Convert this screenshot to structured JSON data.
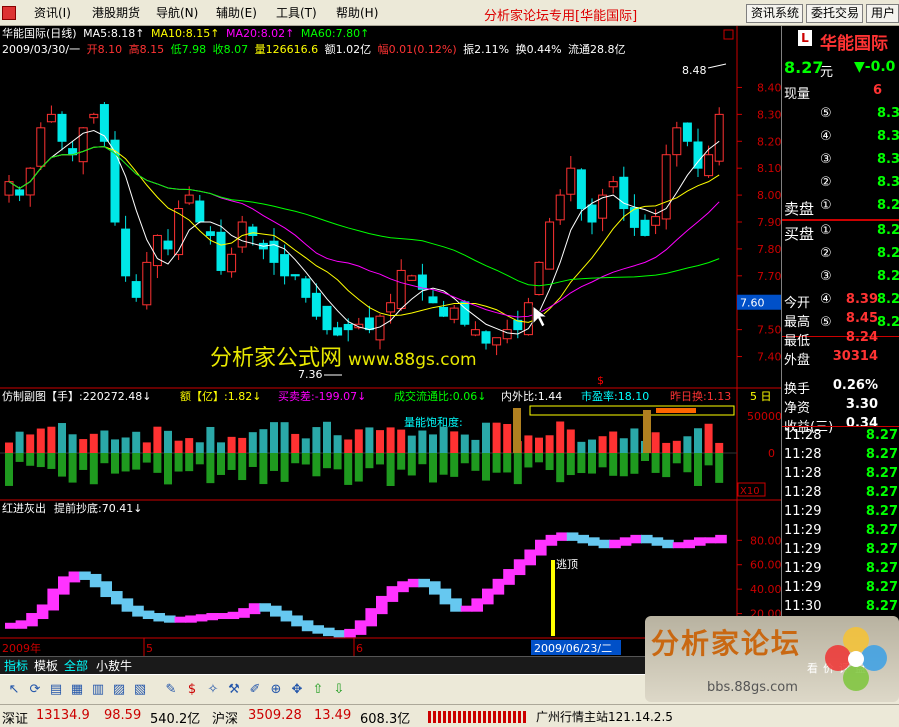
{
  "menu": {
    "items": [
      "资讯(I)",
      "港股期货",
      "导航(N)",
      "辅助(E)",
      "工具(T)",
      "帮助(H)"
    ],
    "forum_tag": "分析家论坛专用",
    "broker_tag": "[华能国际]",
    "buttons": [
      "资讯系统",
      "委托交易",
      "用户"
    ]
  },
  "main_chart": {
    "title": "华能国际(日线)",
    "ma5": "MA5:8.18↑",
    "ma10": "MA10:8.15↑",
    "ma20": "MA20:8.02↑",
    "ma60": "MA60:7.80↑",
    "date": "2009/03/30/一",
    "open": "开8.10",
    "high": "高8.15",
    "low": "低7.98",
    "close": "收8.07",
    "vol": "量126616.6",
    "amount": "额1.02亿",
    "change": "幅0.01(0.12%)",
    "amplitude": "振2.11%",
    "turnover": "换0.44%",
    "float": "流通28.8亿",
    "price_ticks": [
      "8.40",
      "8.30",
      "8.20",
      "8.10",
      "8.00",
      "7.90",
      "7.80",
      "7.70",
      "7.60",
      "7.50",
      "7.40"
    ],
    "cursor_price": "7.60",
    "high_marker": "8.48",
    "low_marker": "7.36"
  },
  "colors": {
    "up": "#ff3232",
    "down": "#00e8e8",
    "ma5": "#ffffff",
    "ma10": "#ffff00",
    "ma20": "#ff00ff",
    "ma60": "#00ff00",
    "yellow": "#ffff00"
  },
  "vol_panel": {
    "name": "仿制副图",
    "hand": "【手】:220272.48↓",
    "amount": "额【亿】:1.82↓",
    "buysell": "买卖差:-199.07↓",
    "flow": "成交流通比:0.06↓",
    "inout": "内外比:1.44",
    "pe": "市盈率:18.10",
    "prev_turn": "昨日换:1.13",
    "days": "5 日",
    "saturation": "量能饱和度:",
    "ticks": [
      "50000",
      "0"
    ],
    "scale": "X10"
  },
  "ind_panel": {
    "name": "红进灰出",
    "early_buy": "提前抄底:70.41↓",
    "escape": "逃顶",
    "ticks": [
      "80.00",
      "60.00",
      "40.00",
      "20.00"
    ]
  },
  "xaxis": {
    "labels": [
      "2009年",
      "5",
      "6"
    ],
    "cursor_date": "2009/06/23/二"
  },
  "watermark": {
    "text": "分析家公式网",
    "url": "www.88gs.com"
  },
  "right_panel": {
    "stock_name": "华能国际",
    "price": "8.27",
    "unit": "元",
    "change": "▼-0.0",
    "cur_vol_label": "现量",
    "cur_vol": "6",
    "asks": [
      {
        "label": "⑤",
        "price": "8.3"
      },
      {
        "label": "④",
        "price": "8.3"
      },
      {
        "label": "③",
        "price": "8.3"
      },
      {
        "label": "②",
        "price": "8.3"
      },
      {
        "label": "①",
        "price": "8.2"
      }
    ],
    "ask_title": "卖盘",
    "bid_title": "买盘",
    "bids": [
      {
        "label": "①",
        "price": "8.2"
      },
      {
        "label": "②",
        "price": "8.2"
      },
      {
        "label": "③",
        "price": "8.2"
      },
      {
        "label": "④",
        "price": "8.2"
      },
      {
        "label": "⑤",
        "price": "8.2"
      }
    ],
    "stats": [
      {
        "label": "今开",
        "value": "8.39"
      },
      {
        "label": "最高",
        "value": "8.45"
      },
      {
        "label": "最低",
        "value": "8.24"
      },
      {
        "label": "外盘",
        "value": "30314"
      },
      {
        "label": "换手",
        "value": "0.26%"
      },
      {
        "label": "净资",
        "value": "3.30"
      },
      {
        "label": "收益(三)",
        "value": "0.34"
      }
    ],
    "ticks": [
      {
        "time": "11:28",
        "price": "8.27"
      },
      {
        "time": "11:28",
        "price": "8.27"
      },
      {
        "time": "11:28",
        "price": "8.27"
      },
      {
        "time": "11:28",
        "price": "8.27"
      },
      {
        "time": "11:29",
        "price": "8.27"
      },
      {
        "time": "11:29",
        "price": "8.27"
      },
      {
        "time": "11:29",
        "price": "8.27"
      },
      {
        "time": "11:29",
        "price": "8.27"
      },
      {
        "time": "11:29",
        "price": "8.27"
      },
      {
        "time": "11:30",
        "price": "8.27"
      },
      {
        "time": "11:30",
        "price": "8.27"
      }
    ]
  },
  "tabs": [
    "指标",
    "模板",
    "全部",
    "小敖牛"
  ],
  "toolbar_icons": [
    "cursor-icon",
    "refresh-icon",
    "news-icon",
    "f10-icon",
    "kline-icon",
    "chart-icon",
    "rsi-icon",
    "pen-icon",
    "money-icon",
    "wand-icon",
    "tools-icon",
    "edit-icon",
    "zoom-icon",
    "move-icon",
    "up-arrow-icon",
    "down-arrow-icon"
  ],
  "status": {
    "sz_label": "深证",
    "sz_index": "13134.9",
    "sz_change": "98.59",
    "sz_amount": "540.2亿",
    "hs_label": "沪深",
    "hs_index": "3509.28",
    "hs_change": "13.49",
    "hs_amount": "608.3亿",
    "server": "广州行情主站121.14.2.5"
  },
  "logo": {
    "title": "分析家论坛",
    "url": "bbs.88gs.com",
    "sub": "看价评盘"
  }
}
